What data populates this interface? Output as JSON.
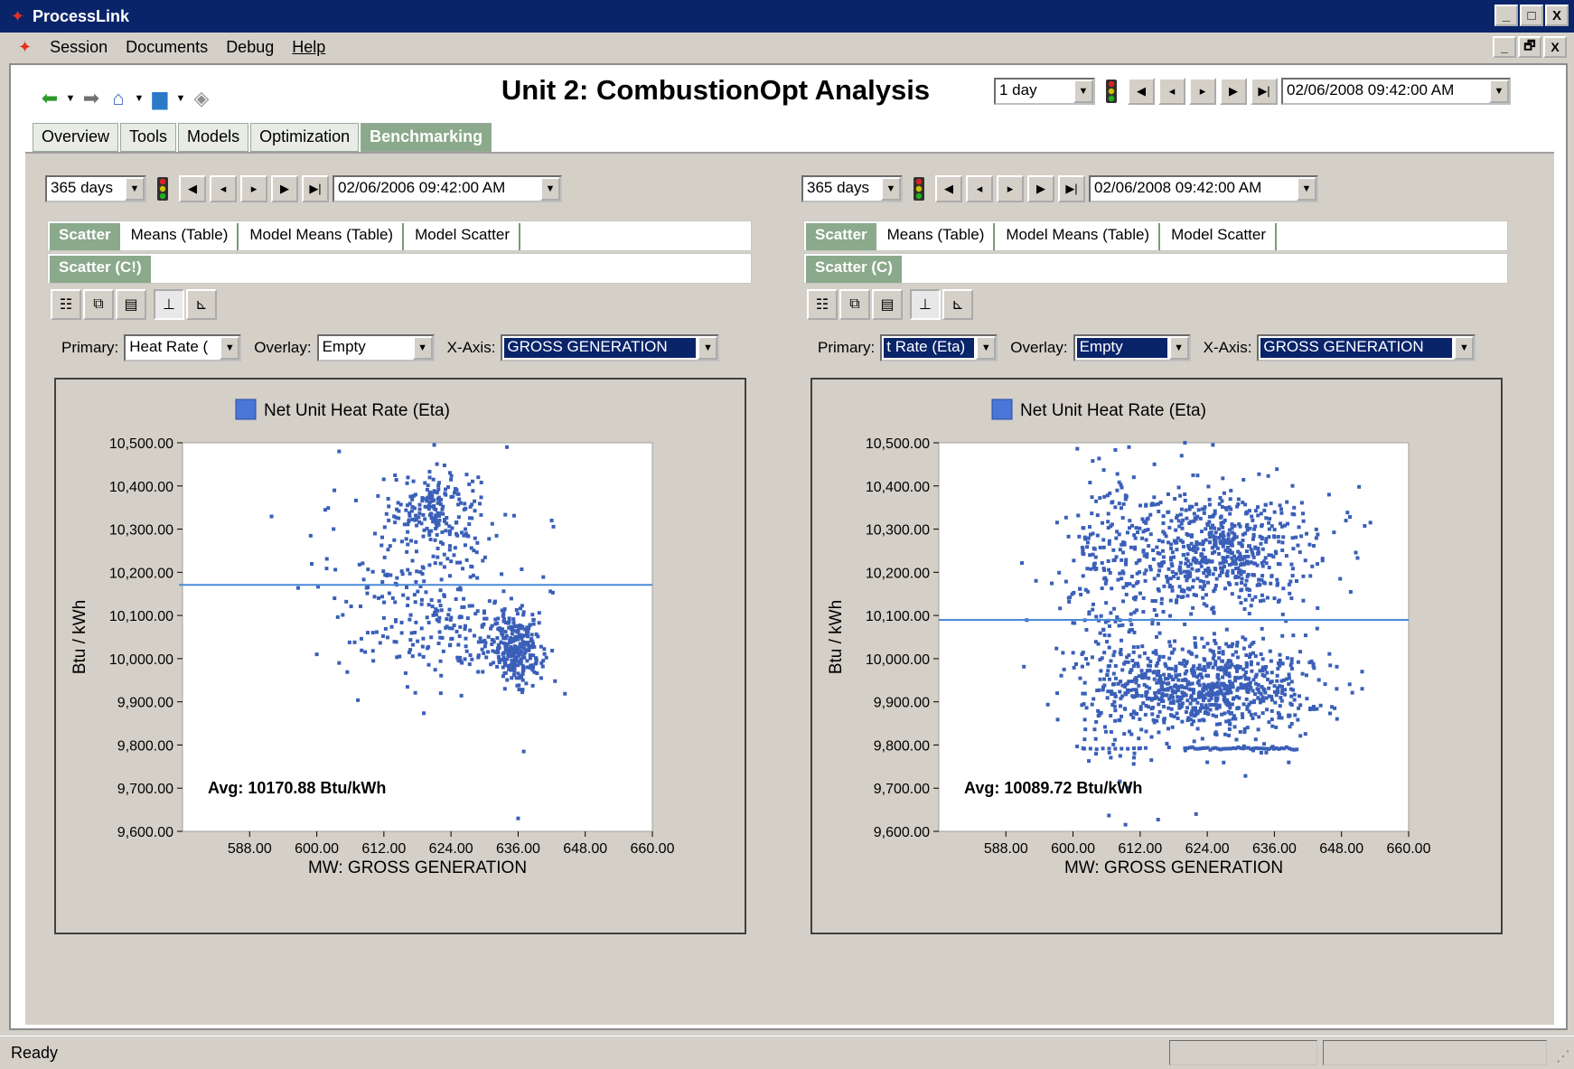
{
  "window": {
    "title": "ProcessLink",
    "buttons": [
      "_",
      "□",
      "X"
    ]
  },
  "menu": {
    "items": [
      "Session",
      "Documents",
      "Debug",
      "Help"
    ],
    "mdi_buttons": [
      "_",
      "🗗",
      "X"
    ]
  },
  "page": {
    "title": "Unit 2: CombustionOpt Analysis",
    "period": "1 day",
    "datetime": "02/06/2008 09:42:00 AM"
  },
  "tabs": [
    "Overview",
    "Tools",
    "Models",
    "Optimization",
    "Benchmarking"
  ],
  "active_tab": "Benchmarking",
  "panels": [
    {
      "period": "365 days",
      "datetime": "02/06/2006 09:42:00 AM",
      "subtabs_row1": [
        "Scatter",
        "Means (Table)",
        "Model Means (Table)",
        "Model Scatter"
      ],
      "subtabs_row2": [
        "Scatter (C!)"
      ],
      "primary_label": "Primary:",
      "primary_value": "Heat Rate (",
      "overlay_label": "Overlay:",
      "overlay_value": "Empty",
      "xaxis_label": "X-Axis:",
      "xaxis_value": "GROSS GENERATION"
    },
    {
      "period": "365 days",
      "datetime": "02/06/2008 09:42:00 AM",
      "subtabs_row1": [
        "Scatter",
        "Means (Table)",
        "Model Means (Table)",
        "Model Scatter"
      ],
      "subtabs_row2": [
        "Scatter (C)"
      ],
      "primary_label": "Primary:",
      "primary_value": "t Rate (Eta)",
      "overlay_label": "Overlay:",
      "overlay_value": "Empty",
      "xaxis_label": "X-Axis:",
      "xaxis_value": "GROSS GENERATION"
    }
  ],
  "chart_data": [
    {
      "type": "scatter",
      "legend": "Net Unit Heat Rate (Eta)",
      "xlabel": "MW: GROSS GENERATION",
      "ylabel": "Btu / kWh",
      "xlim": [
        576,
        660
      ],
      "ylim": [
        9600,
        10500
      ],
      "x_ticks": [
        "588.00",
        "600.00",
        "612.00",
        "624.00",
        "636.00",
        "648.00",
        "660.00"
      ],
      "y_ticks": [
        "10,500.00",
        "10,400.00",
        "10,300.00",
        "10,200.00",
        "10,100.00",
        "10,000.00",
        "9,900.00",
        "9,800.00",
        "9,700.00",
        "9,600.00"
      ],
      "avg_value": 10170.88,
      "avg_text": "Avg: 10170.88 Btu/kWh",
      "series_color": "#3a5fb8",
      "avg_line_color": "#4a8ad8",
      "clusters": [
        {
          "cx": 621,
          "cy": 10350,
          "sx": 4,
          "sy": 45,
          "n": 180
        },
        {
          "cx": 636,
          "cy": 10020,
          "sx": 2.2,
          "sy": 40,
          "n": 260
        },
        {
          "cx": 618,
          "cy": 10170,
          "sx": 9,
          "sy": 120,
          "n": 220
        },
        {
          "cx": 628,
          "cy": 10050,
          "sx": 6,
          "sy": 45,
          "n": 90
        }
      ],
      "points": [
        [
          636,
          9630
        ],
        [
          637,
          9785
        ],
        [
          600,
          10010
        ],
        [
          604,
          9990
        ],
        [
          642,
          10320
        ],
        [
          604,
          10480
        ],
        [
          621,
          10495
        ],
        [
          634,
          10490
        ]
      ]
    },
    {
      "type": "scatter",
      "legend": "Net Unit Heat Rate (Eta)",
      "xlabel": "MW: GROSS GENERATION",
      "ylabel": "Btu / kWh",
      "xlim": [
        576,
        660
      ],
      "ylim": [
        9600,
        10500
      ],
      "x_ticks": [
        "588.00",
        "600.00",
        "612.00",
        "624.00",
        "636.00",
        "648.00",
        "660.00"
      ],
      "y_ticks": [
        "10,500.00",
        "10,400.00",
        "10,300.00",
        "10,200.00",
        "10,100.00",
        "10,000.00",
        "9,900.00",
        "9,800.00",
        "9,700.00",
        "9,600.00"
      ],
      "avg_value": 10089.72,
      "avg_text": "Avg: 10089.72 Btu/kWh",
      "series_color": "#3a5fb8",
      "avg_line_color": "#4a8ad8",
      "clusters": [
        {
          "cx": 624,
          "cy": 10250,
          "sx": 10,
          "sy": 70,
          "n": 700
        },
        {
          "cx": 624,
          "cy": 9930,
          "sx": 10,
          "sy": 55,
          "n": 800
        },
        {
          "cx": 606,
          "cy": 10100,
          "sx": 4,
          "sy": 200,
          "n": 220
        }
      ],
      "points": [
        [
          622,
          9640
        ],
        [
          614,
          9765
        ],
        [
          624,
          9760
        ],
        [
          620,
          10500
        ],
        [
          625,
          10495
        ],
        [
          610,
          10490
        ]
      ],
      "band": {
        "x_start": 620,
        "x_end": 640,
        "y": 9792,
        "n": 45
      },
      "band2": {
        "x_start": 602,
        "x_end": 612,
        "y": 9792,
        "n": 10
      }
    }
  ],
  "status": {
    "text": "Ready"
  }
}
